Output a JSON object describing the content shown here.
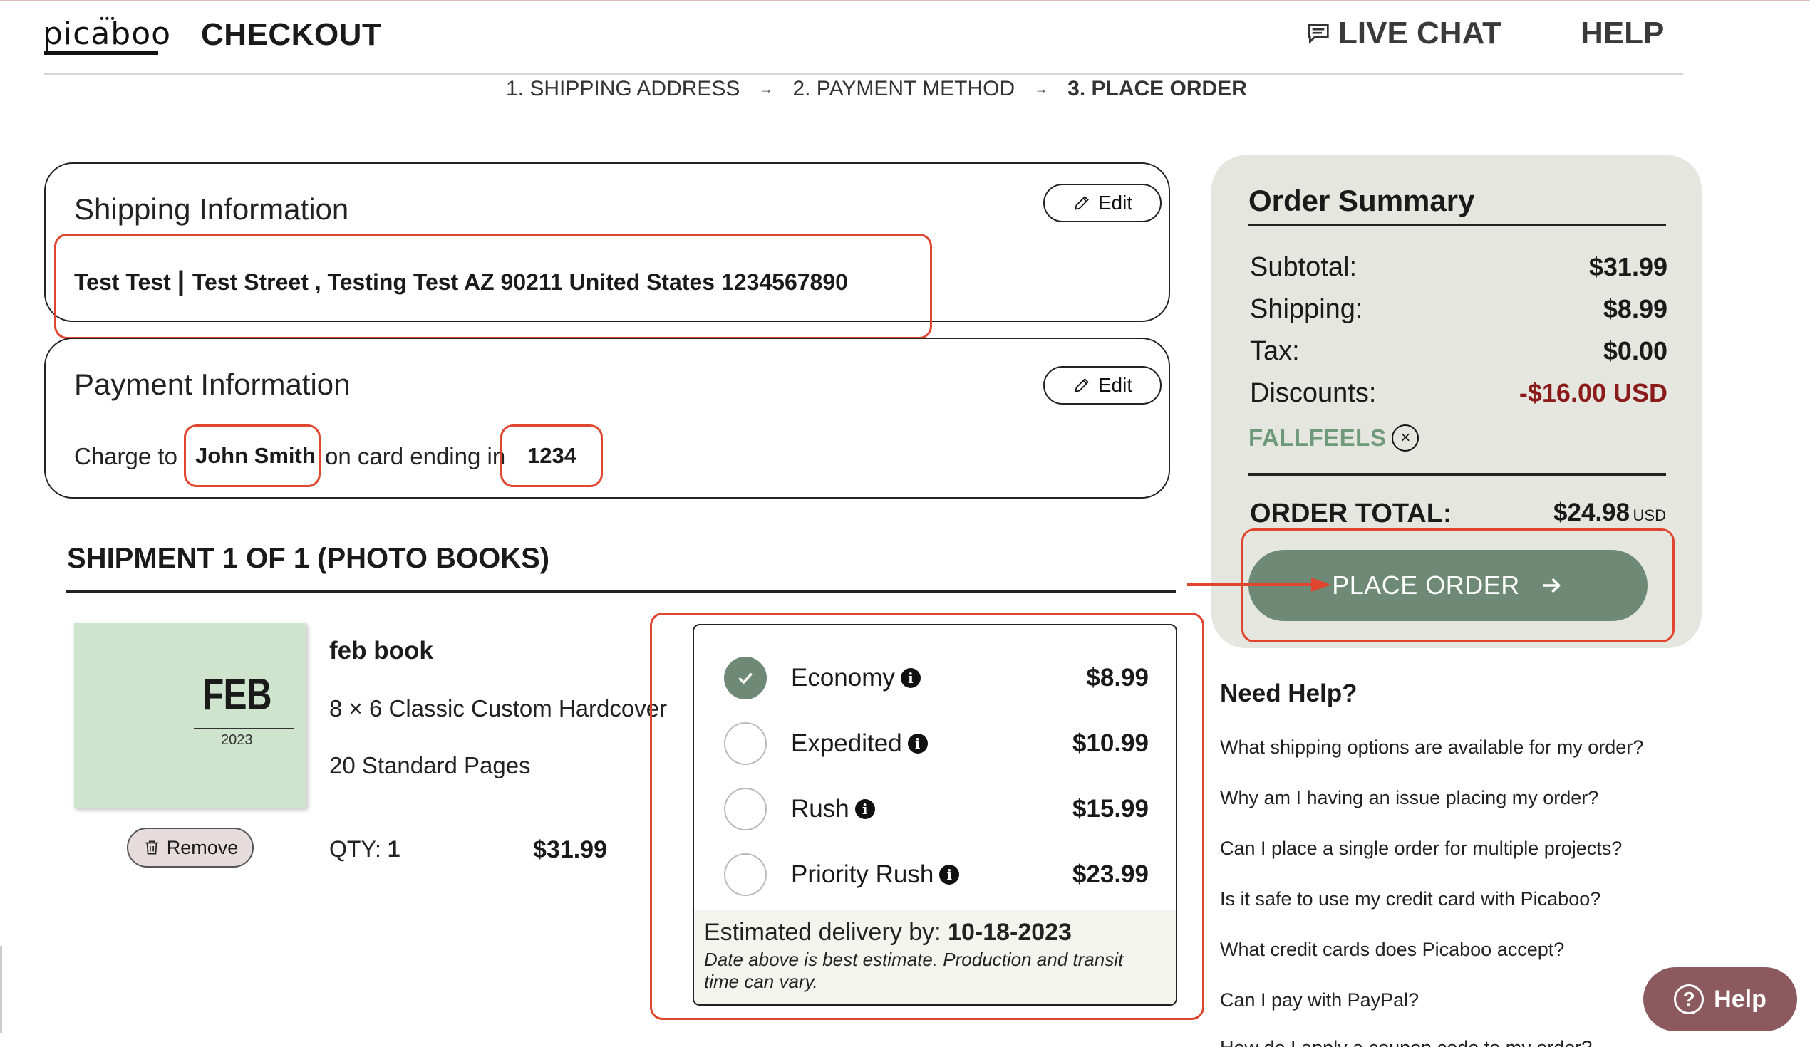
{
  "header": {
    "logo_text": "picaboo",
    "title": "CHECKOUT",
    "live_chat": "LIVE CHAT",
    "help": "HELP"
  },
  "steps": [
    {
      "label": "1. SHIPPING ADDRESS"
    },
    {
      "label": "2. PAYMENT METHOD"
    },
    {
      "label": "3. PLACE ORDER"
    }
  ],
  "shipping_info": {
    "title": "Shipping Information",
    "edit_label": "Edit",
    "address_name": "Test Test",
    "address_rest": "Test Street , Testing Test AZ 90211 United States 1234567890"
  },
  "payment_info": {
    "title": "Payment Information",
    "edit_label": "Edit",
    "charge_to": "Charge to",
    "cardholder": "John Smith",
    "card_ending_text": "on card ending in",
    "card_last4": "1234"
  },
  "shipment": {
    "title": "SHIPMENT 1 OF 1 (PHOTO BOOKS)",
    "product": {
      "cover_month": "FEB",
      "cover_year": "2023",
      "name": "feb book",
      "spec": "8 × 6 Classic Custom Hardcover",
      "pages": "20 Standard Pages",
      "qty_label": "QTY:",
      "qty_value": "1",
      "price": "$31.99",
      "remove_label": "Remove"
    },
    "shipping_options": [
      {
        "name": "Economy",
        "price": "$8.99",
        "selected": true
      },
      {
        "name": "Expedited",
        "price": "$10.99",
        "selected": false
      },
      {
        "name": "Rush",
        "price": "$15.99",
        "selected": false
      },
      {
        "name": "Priority Rush",
        "price": "$23.99",
        "selected": false
      }
    ],
    "estimate_label": "Estimated delivery by:",
    "estimate_date": "10-18-2023",
    "estimate_note": "Date above is best estimate. Production and transit time can vary."
  },
  "summary": {
    "title": "Order Summary",
    "subtotal_label": "Subtotal:",
    "subtotal": "$31.99",
    "shipping_label": "Shipping:",
    "shipping": "$8.99",
    "tax_label": "Tax:",
    "tax": "$0.00",
    "discounts_label": "Discounts:",
    "discounts": "-$16.00 USD",
    "coupon": "FALLFEELS",
    "total_label": "ORDER TOTAL:",
    "total": "$24.98",
    "total_currency": "USD",
    "place_order": "PLACE ORDER"
  },
  "need_help": {
    "title": "Need Help?",
    "links": [
      "What shipping options are available for my order?",
      "Why am I having an issue placing my order?",
      "Can I place a single order for multiple projects?",
      "Is it safe to use my credit card with Picaboo?",
      "What credit cards does Picaboo accept?",
      "Can I pay with PayPal?",
      "How do I apply a coupon code to my order?"
    ]
  },
  "help_widget": {
    "label": "Help"
  },
  "colors": {
    "accent_green": "#6e8a77",
    "summary_bg": "#e4e6df",
    "coupon_green": "#6e9a7a",
    "discount_red": "#8b1a1a",
    "annotation_red": "#e0452f",
    "help_widget": "#8c5a5e"
  }
}
